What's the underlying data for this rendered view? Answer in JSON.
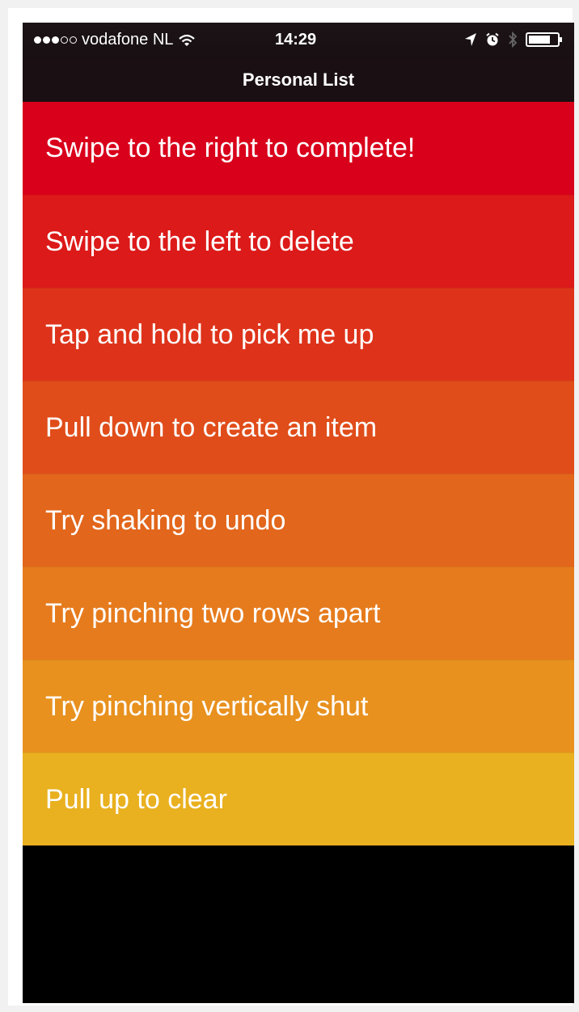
{
  "status_bar": {
    "signal": {
      "filled": 3,
      "total": 5
    },
    "carrier": "vodafone NL",
    "time": "14:29",
    "icons": [
      "wifi-icon",
      "location-arrow-icon",
      "alarm-icon",
      "bluetooth-icon",
      "battery-icon"
    ]
  },
  "nav": {
    "title": "Personal List"
  },
  "list": {
    "items": [
      {
        "label": "Swipe to the right to complete!",
        "color": "#d9001b"
      },
      {
        "label": "Swipe to the left to delete",
        "color": "#dc1a19"
      },
      {
        "label": "Tap and hold to pick me up",
        "color": "#de331a"
      },
      {
        "label": "Pull down to create an item",
        "color": "#e04d1a"
      },
      {
        "label": "Try shaking to undo",
        "color": "#e2661b"
      },
      {
        "label": "Try pinching two rows apart",
        "color": "#e67b1d"
      },
      {
        "label": "Try pinching vertically shut",
        "color": "#e8911f"
      },
      {
        "label": "Pull up to clear",
        "color": "#e9b01f"
      }
    ]
  }
}
